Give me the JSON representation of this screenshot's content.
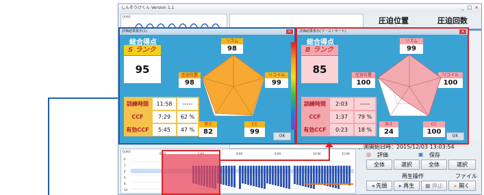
{
  "window": {
    "title": "しんぞうけくん  Version 1.1",
    "controls": [
      "_",
      "□",
      "×"
    ]
  },
  "tabs": [
    "圧迫位置",
    "圧迫回数"
  ],
  "wave_axis": "(cm)",
  "popup_left": {
    "title": "評価結果表示(1)",
    "total_label": "総合得点",
    "rank": "S ランク",
    "score": "95",
    "metrics": {
      "rhythm": {
        "label": "リズム",
        "value": "98"
      },
      "position": {
        "label": "圧迫位置",
        "value": "98"
      },
      "recoil": {
        "label": "リコイル",
        "value": "99"
      },
      "depth": {
        "label": "深さ",
        "value": "82"
      },
      "cc": {
        "label": "CC",
        "value": "99"
      }
    },
    "table": [
      {
        "label": "訓練時間",
        "time": "11:58",
        "pct": "-----"
      },
      {
        "label": "CCF",
        "time": "7:29",
        "pct": "62 %"
      },
      {
        "label": "有効CCF",
        "time": "5:45",
        "pct": "47 %"
      }
    ],
    "ok": "OK"
  },
  "popup_right": {
    "title": "評価結果表示(ワーストモード)",
    "total_label": "総合得点",
    "rank": "B ランク",
    "score": "85",
    "metrics": {
      "rhythm": {
        "label": "リズム",
        "value": "99"
      },
      "position": {
        "label": "圧迫位置",
        "value": "100"
      },
      "recoil": {
        "label": "リコイル",
        "value": "100"
      },
      "depth": {
        "label": "深さ",
        "value": "24"
      },
      "cc": {
        "label": "CC",
        "value": "100"
      }
    },
    "table": [
      {
        "label": "訓練時間",
        "time": "2:03",
        "pct": "-----"
      },
      {
        "label": "CCF",
        "time": "1:37",
        "pct": "79 %"
      },
      {
        "label": "有効CCF",
        "time": "0:23",
        "pct": "18 %"
      }
    ],
    "ok": "OK"
  },
  "right_panel": {
    "measure_start": "計測開始日時：2015/12/03 13:03:54",
    "eval_label": "評価",
    "save_label": "保存",
    "buttons_row1": [
      "全体",
      "選択",
      "全体",
      "選択"
    ],
    "playback_label": "再生操作",
    "file_label": "ファイル",
    "buttons_row2": [
      "先頭",
      "再生",
      "停止",
      "開く"
    ]
  },
  "bottom_chart": {
    "axis_unit": "(cm)",
    "y_ticks": [
      "0",
      "2",
      "4",
      "6",
      "8",
      "10"
    ],
    "x_ticks": [
      "6:00",
      "7:00",
      "8:00",
      "9:00",
      "10:00",
      "11:00"
    ]
  },
  "colors": {
    "popup_blue": "#3aa3d4",
    "popup_pink": "#f6a9b0",
    "highlight_blue": "#1d5fa8",
    "highlight_red": "#d8222a",
    "label_gold": "#f4b71a"
  }
}
